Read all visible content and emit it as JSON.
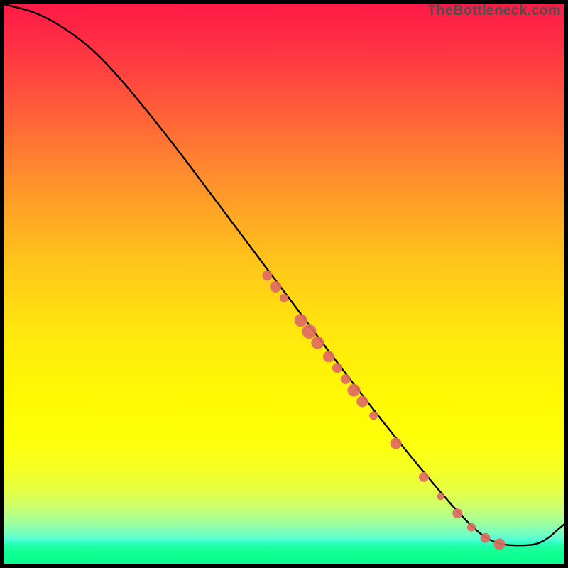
{
  "watermark": "TheBottleneck.com",
  "chart_data": {
    "type": "line",
    "title": "",
    "xlabel": "",
    "ylabel": "",
    "xlim": [
      0,
      100
    ],
    "ylim": [
      0,
      100
    ],
    "curve": [
      {
        "x": 0,
        "y": 100
      },
      {
        "x": 6,
        "y": 98.5
      },
      {
        "x": 12,
        "y": 95
      },
      {
        "x": 18,
        "y": 90
      },
      {
        "x": 28,
        "y": 78
      },
      {
        "x": 40,
        "y": 62
      },
      {
        "x": 52,
        "y": 46
      },
      {
        "x": 64,
        "y": 30
      },
      {
        "x": 76,
        "y": 15
      },
      {
        "x": 84,
        "y": 6
      },
      {
        "x": 88,
        "y": 3.5
      },
      {
        "x": 92,
        "y": 3.2
      },
      {
        "x": 96,
        "y": 3.5
      },
      {
        "x": 100,
        "y": 7
      }
    ],
    "markers": [
      {
        "x": 47,
        "y": 51.5,
        "r": 7
      },
      {
        "x": 48.5,
        "y": 49.5,
        "r": 8
      },
      {
        "x": 50,
        "y": 47.5,
        "r": 6
      },
      {
        "x": 53,
        "y": 43.5,
        "r": 9
      },
      {
        "x": 54.5,
        "y": 41.5,
        "r": 10
      },
      {
        "x": 56,
        "y": 39.5,
        "r": 9
      },
      {
        "x": 58,
        "y": 37,
        "r": 8
      },
      {
        "x": 59.5,
        "y": 35,
        "r": 7
      },
      {
        "x": 61,
        "y": 33,
        "r": 7
      },
      {
        "x": 62.5,
        "y": 31,
        "r": 9
      },
      {
        "x": 64,
        "y": 29,
        "r": 8
      },
      {
        "x": 66,
        "y": 26.5,
        "r": 6
      },
      {
        "x": 70,
        "y": 21.5,
        "r": 8
      },
      {
        "x": 75,
        "y": 15.5,
        "r": 7
      },
      {
        "x": 78,
        "y": 12,
        "r": 5
      },
      {
        "x": 81,
        "y": 9,
        "r": 7
      },
      {
        "x": 83.5,
        "y": 6.5,
        "r": 6
      },
      {
        "x": 86,
        "y": 4.6,
        "r": 7
      },
      {
        "x": 88.5,
        "y": 3.5,
        "r": 8
      }
    ],
    "marker_color": "#e06a62",
    "curve_color": "#000000"
  }
}
